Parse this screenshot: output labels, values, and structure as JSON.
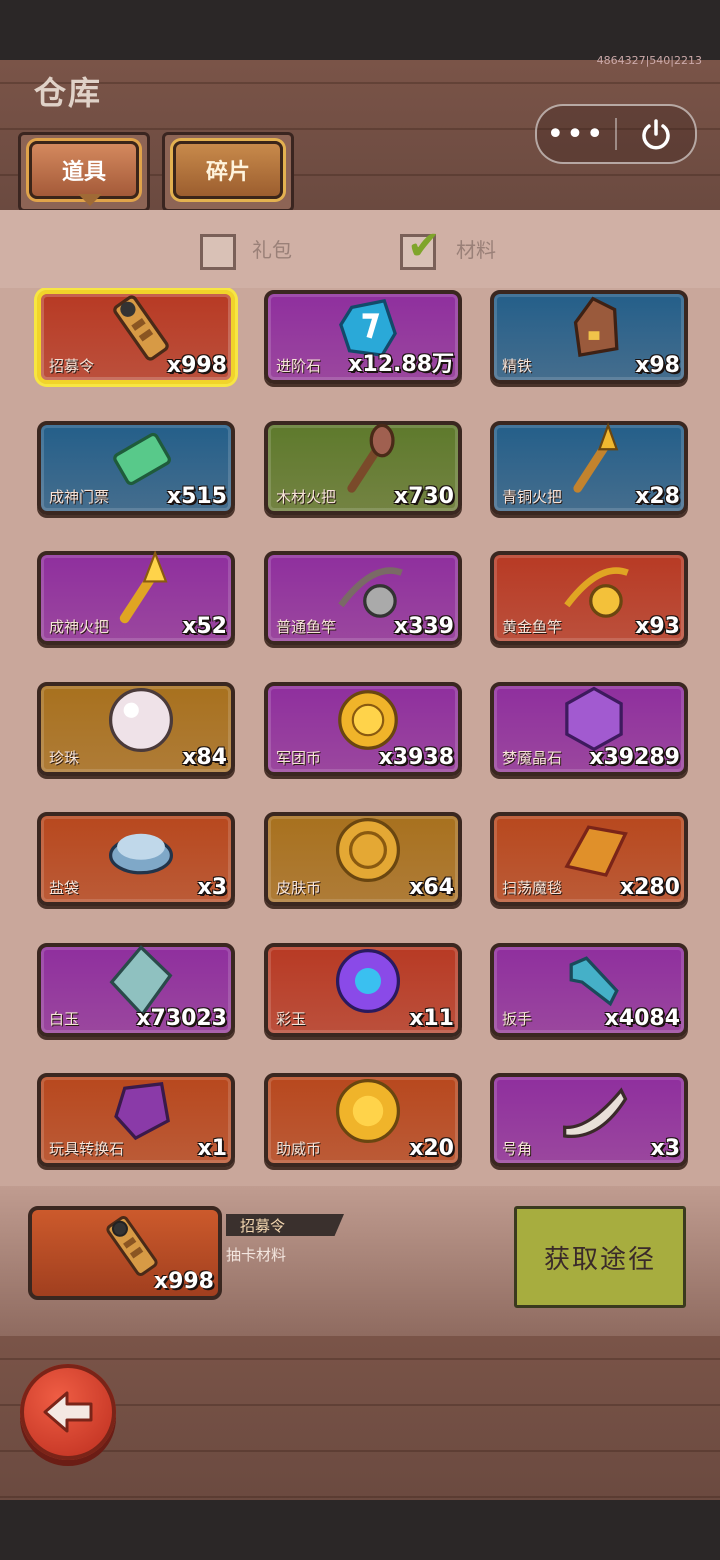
{
  "header": {
    "title": "仓库",
    "build_id": "4864327|540|2213",
    "tabs": [
      {
        "label": "道具",
        "active": true
      },
      {
        "label": "碎片",
        "active": false
      }
    ]
  },
  "filters": [
    {
      "label": "礼包",
      "checked": false
    },
    {
      "label": "材料",
      "checked": true
    }
  ],
  "items": [
    {
      "name": "招募令",
      "count": "x998",
      "color": "#b83a24",
      "icon": "scroll-icon",
      "selected": true
    },
    {
      "name": "进阶石",
      "count": "x12.88万",
      "color": "#8f2f9e",
      "icon": "blue-rune-stone-icon"
    },
    {
      "name": "精铁",
      "count": "x98",
      "color": "#245f8a",
      "icon": "iron-ingot-icon"
    },
    {
      "name": "成神门票",
      "count": "x515",
      "color": "#245f8a",
      "icon": "green-ticket-icon"
    },
    {
      "name": "木材火把",
      "count": "x730",
      "color": "#5e7a2c",
      "icon": "wood-torch-icon"
    },
    {
      "name": "青铜火把",
      "count": "x28",
      "color": "#245f8a",
      "icon": "bronze-torch-icon"
    },
    {
      "name": "成神火把",
      "count": "x52",
      "color": "#8f2f9e",
      "icon": "gold-torch-icon"
    },
    {
      "name": "普通鱼竿",
      "count": "x339",
      "color": "#8f2f9e",
      "icon": "fishing-rod-icon"
    },
    {
      "name": "黄金鱼竿",
      "count": "x93",
      "color": "#b83a24",
      "icon": "golden-rod-icon"
    },
    {
      "name": "珍珠",
      "count": "x84",
      "color": "#a8711e",
      "icon": "pearl-icon"
    },
    {
      "name": "军团币",
      "count": "x3938",
      "color": "#8f2f9e",
      "icon": "legion-coin-icon"
    },
    {
      "name": "梦魇晶石",
      "count": "x39289",
      "color": "#8f2f9e",
      "icon": "crystal-icon"
    },
    {
      "name": "盐袋",
      "count": "x3",
      "color": "#b8481e",
      "icon": "salt-bowl-icon"
    },
    {
      "name": "皮肤币",
      "count": "x64",
      "color": "#a8711e",
      "icon": "skin-coin-icon"
    },
    {
      "name": "扫荡魔毯",
      "count": "x280",
      "color": "#b8481e",
      "icon": "magic-carpet-icon"
    },
    {
      "name": "白玉",
      "count": "x73023",
      "color": "#8f2f9e",
      "icon": "white-jade-icon"
    },
    {
      "name": "彩玉",
      "count": "x11",
      "color": "#b83a24",
      "icon": "rainbow-jade-icon"
    },
    {
      "name": "扳手",
      "count": "x4084",
      "color": "#8f2f9e",
      "icon": "wrench-icon"
    },
    {
      "name": "玩具转换石",
      "count": "x1",
      "color": "#b8481e",
      "icon": "toy-stone-icon"
    },
    {
      "name": "助威币",
      "count": "x20",
      "color": "#b8481e",
      "icon": "cheer-coin-icon"
    },
    {
      "name": "号角",
      "count": "x3",
      "color": "#8f2f9e",
      "icon": "horn-icon"
    }
  ],
  "detail": {
    "name": "招募令",
    "description": "抽卡材料",
    "count": "x998",
    "action_label": "获取途径"
  }
}
